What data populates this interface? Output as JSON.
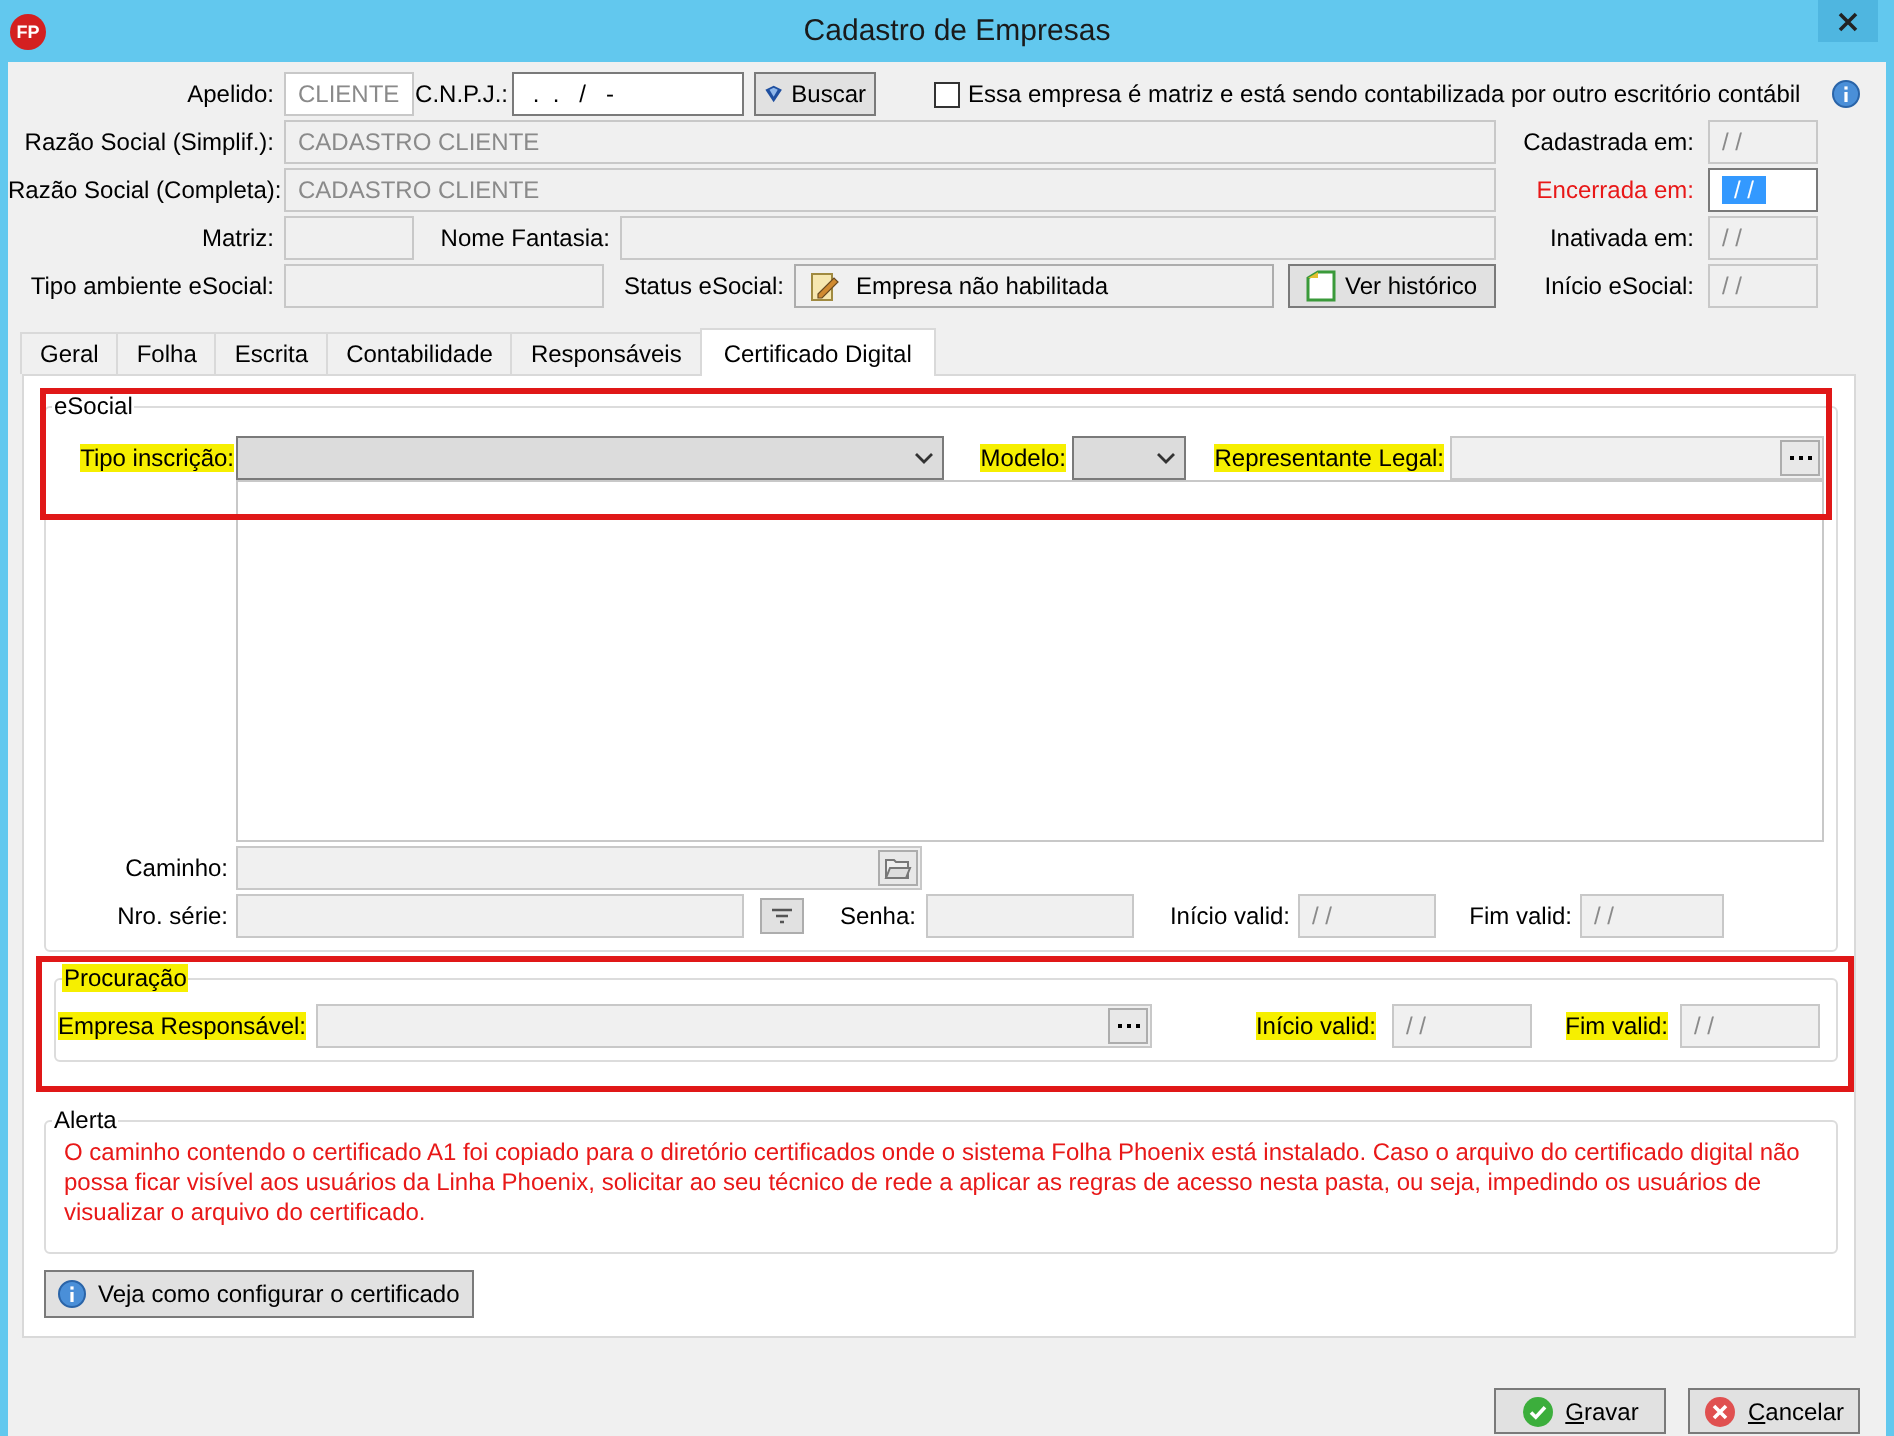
{
  "window": {
    "app_icon": "FP",
    "title": "Cadastro de Empresas"
  },
  "company": {
    "apelido": {
      "label": "Apelido:",
      "value": "CLIENTE"
    },
    "cnpj": {
      "label": "C.N.P.J.:",
      "value": " .  .   /   -"
    },
    "search_button": "Buscar",
    "matriz_checkbox": {
      "label": "Essa empresa é matriz e está sendo contabilizada por outro escritório contábil",
      "checked": false
    },
    "razao_simplificada": {
      "label": "Razão Social (Simplif.):",
      "value": "CADASTRO CLIENTE"
    },
    "razao_completa": {
      "label": "Razão Social (Completa):",
      "value": "CADASTRO CLIENTE"
    },
    "matriz": {
      "label": "Matriz:"
    },
    "nome_fantasia": {
      "label": "Nome Fantasia:"
    },
    "tipo_ambiente": {
      "label": "Tipo ambiente eSocial:"
    },
    "status_esocial": {
      "label": "Status eSocial:",
      "value": "Empresa não habilitada"
    },
    "history_button": "Ver histórico"
  },
  "dates": [
    {
      "label": "Cadastrada em:",
      "value": "/ /",
      "warning": false,
      "selected": false
    },
    {
      "label": "Encerrada em:",
      "value": "/ /",
      "warning": true,
      "selected": true
    },
    {
      "label": "Inativada em:",
      "value": "/ /",
      "warning": false,
      "selected": false
    },
    {
      "label": "Início eSocial:",
      "value": "/ /",
      "warning": false,
      "selected": false
    }
  ],
  "tabs": [
    {
      "label": "Geral",
      "selected": false
    },
    {
      "label": "Folha",
      "selected": false
    },
    {
      "label": "Escrita",
      "selected": false
    },
    {
      "label": "Contabilidade",
      "selected": false
    },
    {
      "label": "Responsáveis",
      "selected": false
    },
    {
      "label": "Certificado Digital",
      "selected": true
    }
  ],
  "esocial": {
    "title": "eSocial",
    "boxed": true,
    "tipo_inscricao": {
      "label": "Tipo inscrição:",
      "highlighted": true
    },
    "modelo": {
      "label": "Modelo:",
      "highlighted": true
    },
    "representante": {
      "label": "Representante Legal:",
      "highlighted": true
    },
    "caminho": {
      "label": "Caminho:"
    },
    "serie": {
      "label": "Nro. série:"
    },
    "senha": {
      "label": "Senha:"
    },
    "inicio": {
      "label": "Início valid:",
      "value": "/ /"
    },
    "fim": {
      "label": "Fim valid:",
      "value": "/ /"
    }
  },
  "procuracao": {
    "title": "Procuração",
    "title_highlighted": true,
    "boxed": true,
    "empresa": {
      "label": "Empresa Responsável:",
      "highlighted": true
    },
    "inicio": {
      "label": "Início valid:",
      "value": "/ /",
      "highlighted": true
    },
    "fim": {
      "label": "Fim valid:",
      "value": "/ /",
      "highlighted": true
    }
  },
  "alert": {
    "title": "Alerta",
    "text": "O caminho contendo o certificado A1 foi copiado para o diretório certificados onde o sistema Folha Phoenix está instalado. Caso o arquivo do certificado digital não possa ficar visível aos usuários da Linha Phoenix, solicitar ao seu técnico de rede a aplicar as regras de acesso nesta pasta, ou seja, impedindo os usuários de visualizar o arquivo do certificado."
  },
  "help_button": "Veja como configurar o certificado",
  "buttons": [
    {
      "label": "Gravar",
      "kind": "save"
    },
    {
      "label": "Cancelar",
      "kind": "cancel"
    }
  ]
}
